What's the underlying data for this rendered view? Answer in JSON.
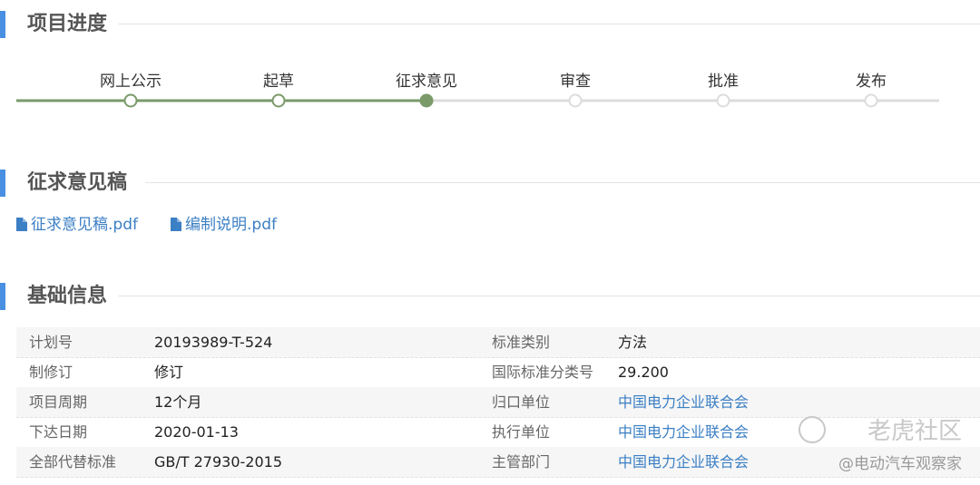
{
  "sections": {
    "progress_title": "项目进度",
    "draft_title": "征求意见稿",
    "info_title": "基础信息"
  },
  "progress": {
    "steps": [
      {
        "label": "网上公示",
        "state": "done"
      },
      {
        "label": "起草",
        "state": "done"
      },
      {
        "label": "征求意见",
        "state": "current"
      },
      {
        "label": "审查",
        "state": "pending"
      },
      {
        "label": "批准",
        "state": "pending"
      },
      {
        "label": "发布",
        "state": "pending"
      }
    ],
    "colors": {
      "done": "#7a9a6a",
      "pending": "#dcdcdc"
    }
  },
  "files": [
    {
      "label": "征求意见稿.pdf",
      "icon": "pdf-file-icon"
    },
    {
      "label": "编制说明.pdf",
      "icon": "pdf-file-icon"
    }
  ],
  "info": {
    "rows": [
      {
        "l1": "计划号",
        "v1": "20193989-T-524",
        "l2": "标准类别",
        "v2": "方法"
      },
      {
        "l1": "制修订",
        "v1": "修订",
        "l2": "国际标准分类号",
        "v2": "29.200"
      },
      {
        "l1": "项目周期",
        "v1": "12个月",
        "l2": "归口单位",
        "v2": "中国电力企业联合会"
      },
      {
        "l1": "下达日期",
        "v1": "2020-01-13",
        "l2": "执行单位",
        "v2": "中国电力企业联合会"
      },
      {
        "l1": "全部代替标准",
        "v1": "GB/T 27930-2015",
        "l2": "主管部门",
        "v2": "中国电力企业联合会"
      }
    ]
  },
  "watermark": {
    "top": "老虎社区",
    "bottom": "@电动汽车观察家"
  },
  "accent": "#4a90e2",
  "link_color": "#3b7fc4"
}
